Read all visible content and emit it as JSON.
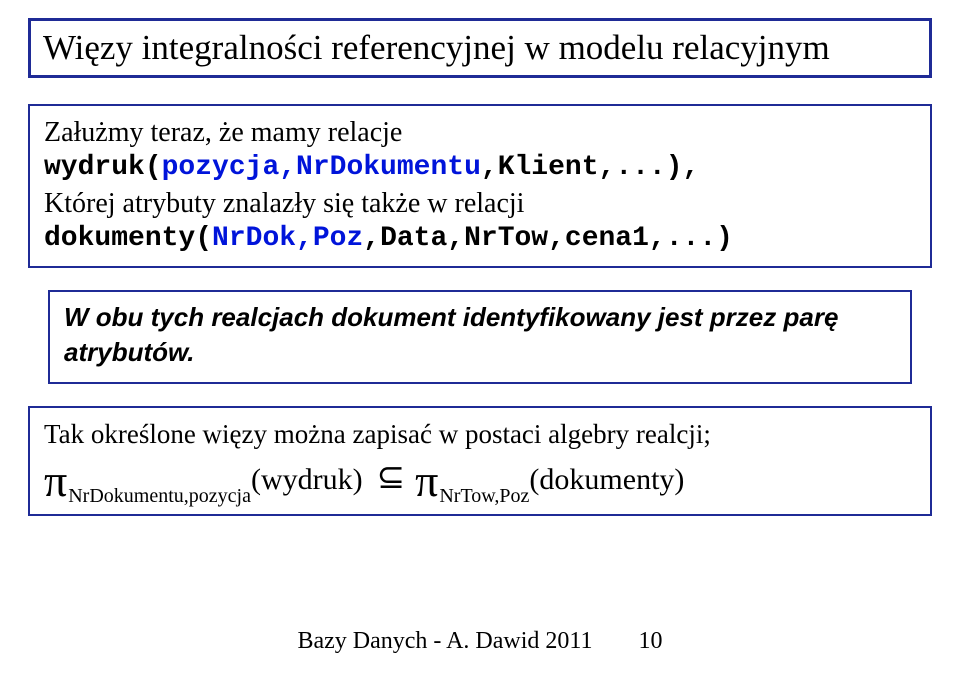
{
  "title": "Więzy integralności referencyjnej w modelu relacyjnym",
  "box1": {
    "intro": "Załużmy teraz, że mamy relacje",
    "code1a": "wydruk(",
    "code1b": "pozycja,NrDokumentu",
    "code1c": ",Klient,...),",
    "sub": "Której atrybuty znalazły się także w relacji",
    "code2a": "dokumenty(",
    "code2b": "NrDok,Poz",
    "code2c": ",Data,NrTow,cena1,...)"
  },
  "box2": {
    "text": "W obu tych realcjach dokument identyfikowany jest przez parę atrybutów."
  },
  "box3": {
    "line1": "Tak określone więzy można zapisać w postaci algebry realcji;",
    "pi": "π",
    "sub1": "NrDokumentu,pozycja",
    "arg1": "(wydruk)",
    "subset": "⊆",
    "sub2": "NrTow,Poz",
    "arg2": "(dokumenty)"
  },
  "footer": {
    "text": "Bazy Danych - A. Dawid 2011",
    "page": "10"
  }
}
